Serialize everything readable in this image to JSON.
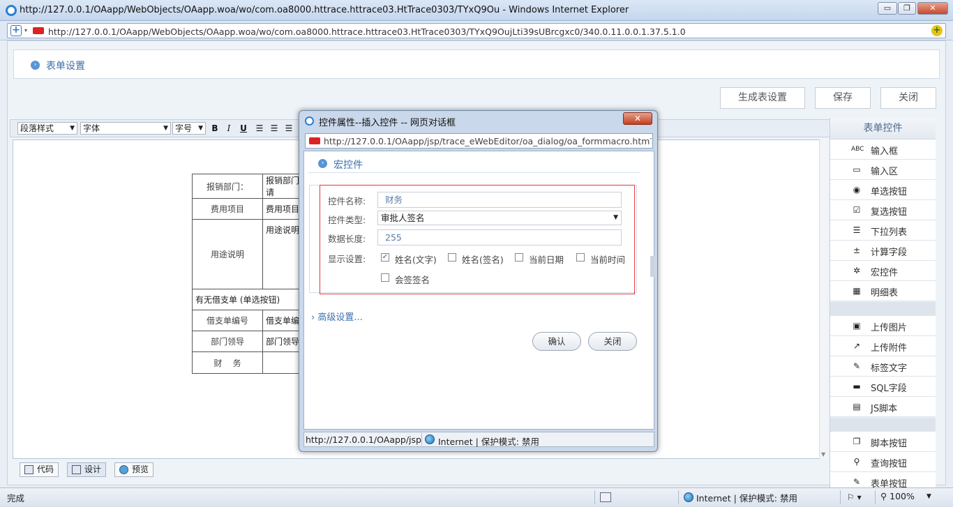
{
  "window": {
    "title": "http://127.0.0.1/OAapp/WebObjects/OAapp.woa/wo/com.oa8000.httrace.httrace03.HtTrace0303/TYxQ9Ou - Windows Internet Explorer",
    "address": "http://127.0.0.1/OAapp/WebObjects/OAapp.woa/wo/com.oa8000.httrace.httrace03.HtTrace0303/TYxQ9OujLti39sUBrcgxc0/340.0.11.0.0.1.37.5.1.0",
    "min_label": "▭",
    "max_label": "❐",
    "close_label": "✕"
  },
  "page": {
    "section_title": "表单设置",
    "buttons": {
      "generate": "生成表设置",
      "save": "保存",
      "close": "关闭"
    }
  },
  "toolbar": {
    "paragraph_style": "段落样式",
    "font": "字体",
    "font_size": "字号",
    "bold": "B",
    "italic": "I",
    "underline": "U"
  },
  "form_table": {
    "dept_label": "报销部门：",
    "dept_value": "报销部门(申请",
    "cost_item_label": "费用项目",
    "cost_item_value": "费用项目",
    "purpose_label": "用途说明",
    "purpose_value": "用途说明",
    "loan_row": "有无借支单 (单选按钮)",
    "loan_no_label": "借支单编号",
    "loan_no_value": "借支单编",
    "leader_label": "部门领导",
    "leader_value": "部门领导",
    "finance_label": "财    务"
  },
  "editor_tabs": {
    "code": "代码",
    "design": "设计",
    "preview": "预览"
  },
  "right_panel": {
    "title": "表单控件",
    "group1": [
      {
        "icon": "ABC",
        "label": "输入框"
      },
      {
        "icon": "▭",
        "label": "输入区"
      },
      {
        "icon": "◉",
        "label": "单选按钮"
      },
      {
        "icon": "☑",
        "label": "复选按钮"
      },
      {
        "icon": "☰",
        "label": "下拉列表"
      },
      {
        "icon": "±",
        "label": "计算字段"
      },
      {
        "icon": "✲",
        "label": "宏控件"
      },
      {
        "icon": "▦",
        "label": "明细表"
      }
    ],
    "group2": [
      {
        "icon": "▣",
        "label": "上传图片"
      },
      {
        "icon": "↗",
        "label": "上传附件"
      },
      {
        "icon": "✎",
        "label": "标签文字"
      },
      {
        "icon": "▬",
        "label": "SQL字段"
      },
      {
        "icon": "▤",
        "label": "JS脚本"
      }
    ],
    "group3": [
      {
        "icon": "❐",
        "label": "脚本按钮"
      },
      {
        "icon": "⚲",
        "label": "查询按钮"
      },
      {
        "icon": "✎",
        "label": "表单按钮"
      }
    ]
  },
  "status": {
    "left": "完成",
    "zone": "Internet | 保护模式: 禁用",
    "zoom": "100%"
  },
  "dialog": {
    "title": "控件属性--插入控件 -- 网页对话框",
    "address": "http://127.0.0.1/OAapp/jsp/trace_eWebEditor/oa_dialog/oa_formmacro.htm?actio",
    "section": "宏控件",
    "fields": {
      "name_label": "控件名称:",
      "name_value": "财务",
      "type_label": "控件类型:",
      "type_value": "审批人签名",
      "length_label": "数据长度:",
      "length_value": "255",
      "display_label": "显示设置:"
    },
    "checkboxes": [
      {
        "label": "姓名(文字)",
        "checked": true
      },
      {
        "label": "姓名(签名)",
        "checked": false
      },
      {
        "label": "当前日期",
        "checked": false
      },
      {
        "label": "当前时间",
        "checked": false
      },
      {
        "label": "会签签名",
        "checked": false
      }
    ],
    "advanced": "› 高级设置...",
    "ok": "确认",
    "close": "关闭",
    "status_url": "http://127.0.0.1/OAapp/jsp/t",
    "status_zone": "Internet | 保护模式: 禁用"
  }
}
